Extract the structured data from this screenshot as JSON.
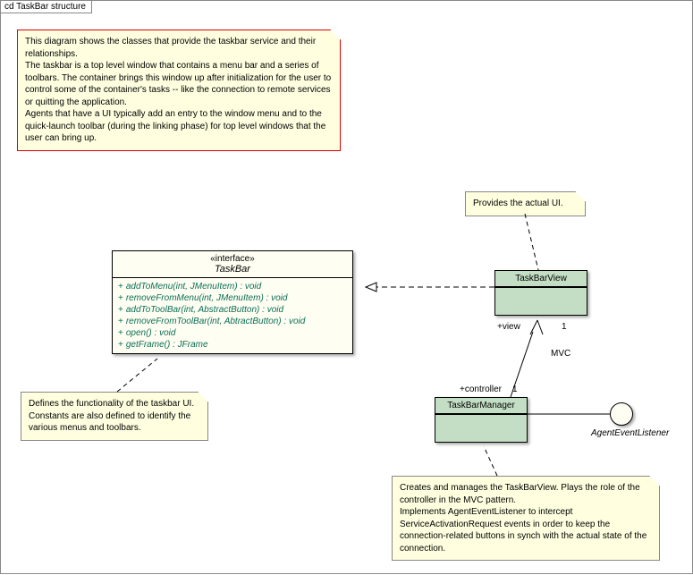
{
  "frame_title": "cd TaskBar structure",
  "notes": {
    "main": "This diagram shows the classes that provide the taskbar service and their relationships.\nThe taskbar is a top level window that contains a menu bar and a series of toolbars. The container brings this window up after initialization for the user to control some of the container's tasks -- like the connection to remote services or quitting the application.\nAgents that have a UI typically add an entry to the window menu and to the quick-launch toolbar (during the linking phase) for top level windows that the user can bring up.",
    "provides_ui": "Provides the actual UI.",
    "defines_func": "Defines the functionality of the taskbar UI.\nConstants are also defined to identify the various menus and toolbars.",
    "manager": "Creates and manages the TaskBarView. Plays the role of the controller in the MVC pattern.\nImplements AgentEventListener to intercept ServiceActivationRequest events in order to keep the connection-related buttons in synch with the actual state of the connection."
  },
  "taskbar": {
    "stereotype": "«interface»",
    "name": "TaskBar",
    "ops": [
      "addToMenu(int, JMenuItem) : void",
      "removeFromMenu(int, JMenuItem) : void",
      "addToToolBar(int, AbstractButton) : void",
      "removeFromToolBar(int, AbtractButton) : void",
      "open() : void",
      "getFrame() : JFrame"
    ]
  },
  "view": {
    "name": "TaskBarView"
  },
  "manager_cls": {
    "name": "TaskBarManager"
  },
  "listener": {
    "name": "AgentEventListener"
  },
  "assoc": {
    "mvc": "MVC",
    "view_role": "+view",
    "view_mult": "1",
    "ctrl_role": "+controller",
    "ctrl_mult": "1"
  }
}
